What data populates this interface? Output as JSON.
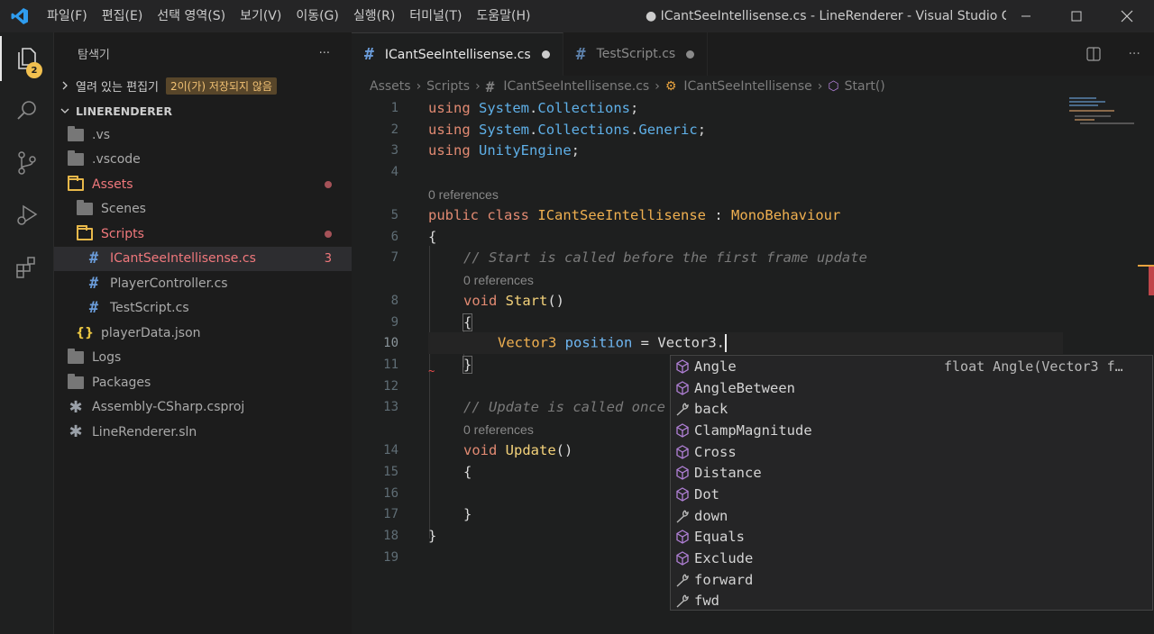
{
  "titlebar": {
    "menu": [
      "파일(F)",
      "편집(E)",
      "선택 영역(S)",
      "보기(V)",
      "이동(G)",
      "실행(R)",
      "터미널(T)",
      "도움말(H)"
    ],
    "window_title": "● ICantSeeIntellisense.cs - LineRenderer - Visual Studio C..."
  },
  "activitybar": {
    "explorer_badge": "2"
  },
  "sidebar": {
    "header": "탐색기",
    "more": "···",
    "open_editors": "열려 있는 편집기",
    "unsaved_badge": "2이(가) 저장되지 않음",
    "project": "LINERENDERER",
    "items": [
      {
        "label": ".vs",
        "type": "folder"
      },
      {
        "label": ".vscode",
        "type": "folder"
      },
      {
        "label": "Assets",
        "type": "folder-open"
      },
      {
        "label": "Scenes",
        "type": "folder"
      },
      {
        "label": "Scripts",
        "type": "folder-open"
      },
      {
        "label": "ICantSeeIntellisense.cs",
        "type": "cs",
        "count": "3"
      },
      {
        "label": "PlayerController.cs",
        "type": "cs"
      },
      {
        "label": "TestScript.cs",
        "type": "cs"
      },
      {
        "label": "playerData.json",
        "type": "json"
      },
      {
        "label": "Logs",
        "type": "folder"
      },
      {
        "label": "Packages",
        "type": "folder"
      },
      {
        "label": "Assembly-CSharp.csproj",
        "type": "proj"
      },
      {
        "label": "LineRenderer.sln",
        "type": "proj"
      }
    ]
  },
  "tabs": [
    {
      "label": "ICantSeeIntellisense.cs",
      "active": true
    },
    {
      "label": "TestScript.cs",
      "active": false
    }
  ],
  "breadcrumb": [
    "Assets",
    "Scripts",
    "ICantSeeIntellisense.cs",
    "ICantSeeIntellisense",
    "Start()"
  ],
  "editor": {
    "line_numbers": [
      "1",
      "2",
      "3",
      "4",
      "5",
      "6",
      "7",
      "8",
      "9",
      "10",
      "11",
      "12",
      "13",
      "14",
      "15",
      "16",
      "17",
      "18",
      "19"
    ],
    "codelens": "0 references",
    "tokens": {
      "using": "using",
      "ns1": "System",
      "ns1b": "Collections",
      "ns2b": "Generic",
      "ns3": "UnityEngine",
      "public": "public",
      "class": "class",
      "classname": "ICantSeeIntellisense",
      "colon": ":",
      "base": "MonoBehaviour",
      "open_brace": "{",
      "close_brace": "}",
      "comment_start": "// Start is called before the first frame update",
      "void": "void",
      "start": "Start",
      "update": "Update",
      "parens": "()",
      "vec_type": "Vector3",
      "var_name": "position",
      "assign": "=",
      "vec_access": "Vector3.",
      "comment_update": "// Update is called once"
    }
  },
  "suggest": {
    "items": [
      {
        "label": "Angle",
        "kind": "method",
        "detail": "float Angle(Vector3 f…"
      },
      {
        "label": "AngleBetween",
        "kind": "method"
      },
      {
        "label": "back",
        "kind": "property"
      },
      {
        "label": "ClampMagnitude",
        "kind": "method"
      },
      {
        "label": "Cross",
        "kind": "method"
      },
      {
        "label": "Distance",
        "kind": "method"
      },
      {
        "label": "Dot",
        "kind": "method"
      },
      {
        "label": "down",
        "kind": "property"
      },
      {
        "label": "Equals",
        "kind": "method"
      },
      {
        "label": "Exclude",
        "kind": "method"
      },
      {
        "label": "forward",
        "kind": "property"
      },
      {
        "label": "fwd",
        "kind": "property"
      }
    ]
  },
  "colors": {
    "keyword": "#e28a72",
    "namespace": "#5fb0e8",
    "class": "#f0b050",
    "modified": "#f0787c",
    "badge": "#f1c04f"
  }
}
